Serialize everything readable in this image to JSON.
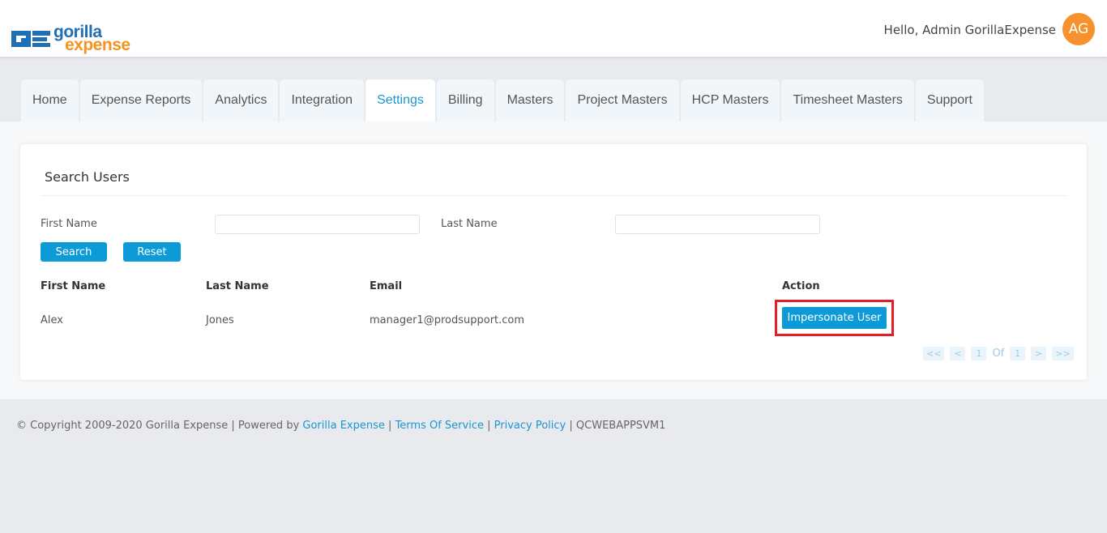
{
  "header": {
    "logo_word1": "gorilla",
    "logo_word2": "expense",
    "greeting": "Hello, Admin GorillaExpense",
    "avatar_initials": "AG"
  },
  "nav": {
    "tabs": [
      {
        "label": "Home",
        "active": false
      },
      {
        "label": "Expense Reports",
        "active": false
      },
      {
        "label": "Analytics",
        "active": false
      },
      {
        "label": "Integration",
        "active": false
      },
      {
        "label": "Settings",
        "active": true
      },
      {
        "label": "Billing",
        "active": false
      },
      {
        "label": "Masters",
        "active": false
      },
      {
        "label": "Project Masters",
        "active": false
      },
      {
        "label": "HCP Masters",
        "active": false
      },
      {
        "label": "Timesheet Masters",
        "active": false
      },
      {
        "label": "Support",
        "active": false
      }
    ]
  },
  "search": {
    "title": "Search Users",
    "first_name_label": "First Name",
    "first_name_value": "",
    "last_name_label": "Last Name",
    "last_name_value": "",
    "search_button": "Search",
    "reset_button": "Reset"
  },
  "table": {
    "headers": [
      "First Name",
      "Last Name",
      "Email",
      "Action"
    ],
    "rows": [
      {
        "first_name": "Alex",
        "last_name": "Jones",
        "email": "manager1@prodsupport.com",
        "action": "Impersonate User"
      }
    ]
  },
  "pager": {
    "first": "<<",
    "prev": "<",
    "current": "1",
    "of": "Of",
    "total": "1",
    "next": ">",
    "last": ">>"
  },
  "footer": {
    "copyright_symbol": "©",
    "copyright": "Copyright 2009-2020 Gorilla Expense",
    "powered_by": "| Powered by",
    "powered_link": "Gorilla Expense",
    "sep1": "|",
    "terms": "Terms Of Service",
    "sep2": "|",
    "privacy": "Privacy Policy",
    "sep3": "|",
    "server": "QCWEBAPPSVM1"
  },
  "colors": {
    "accent": "#0d9bd8",
    "avatar": "#f6912d",
    "highlight": "#e51e25",
    "logo_blue": "#1f6fb4",
    "logo_orange": "#f39321"
  }
}
